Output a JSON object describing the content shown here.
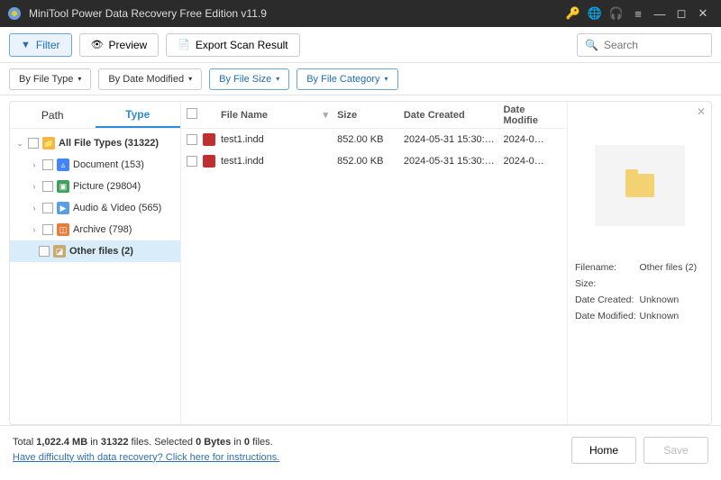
{
  "app": {
    "title": "MiniTool Power Data Recovery Free Edition v11.9"
  },
  "search": {
    "placeholder": "Search"
  },
  "toolbar": {
    "filter": "Filter",
    "preview": "Preview",
    "export": "Export Scan Result"
  },
  "filters": {
    "by_file_type": "By File Type",
    "by_date_modified": "By Date Modified",
    "by_file_size": "By File Size",
    "by_file_category": "By File Category"
  },
  "tabs": {
    "path": "Path",
    "type": "Type"
  },
  "tree": {
    "root": "All File Types (31322)",
    "items": [
      {
        "label": "Document (153)",
        "color": "c-blue"
      },
      {
        "label": "Picture (29804)",
        "color": "c-green"
      },
      {
        "label": "Audio & Video (565)",
        "color": "c-blue2"
      },
      {
        "label": "Archive (798)",
        "color": "c-orange"
      },
      {
        "label": "Other files (2)",
        "color": "c-tan"
      }
    ]
  },
  "columns": {
    "name": "File Name",
    "size": "Size",
    "created": "Date Created",
    "modified": "Date Modifie"
  },
  "files": [
    {
      "name": "test1.indd",
      "size": "852.00 KB",
      "created": "2024-05-31 15:30:…",
      "modified": "2024-0…"
    },
    {
      "name": "test1.indd",
      "size": "852.00 KB",
      "created": "2024-05-31 15:30:…",
      "modified": "2024-0…"
    }
  ],
  "preview": {
    "filename_k": "Filename:",
    "filename_v": "Other files (2)",
    "size_k": "Size:",
    "size_v": "",
    "created_k": "Date Created:",
    "created_v": "Unknown",
    "modified_k": "Date Modified:",
    "modified_v": "Unknown"
  },
  "footer": {
    "total_pre": "Total ",
    "total_mb": "1,022.4 MB",
    "total_mid": " in ",
    "total_files": "31322",
    "total_suf": " files.",
    "sel_pre": "  Selected ",
    "sel_bytes": "0 Bytes",
    "sel_mid": " in ",
    "sel_files": "0",
    "sel_suf": " files.",
    "help": "Have difficulty with data recovery? Click here for instructions.",
    "home": "Home",
    "save": "Save"
  }
}
